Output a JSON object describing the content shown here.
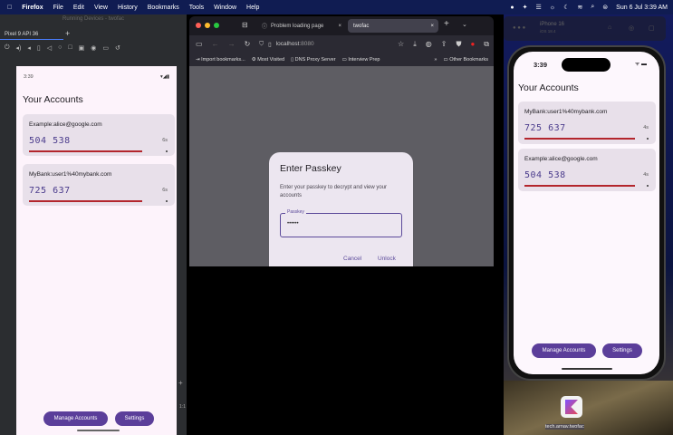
{
  "menubar": {
    "app": "Firefox",
    "items": [
      "File",
      "Edit",
      "View",
      "History",
      "Bookmarks",
      "Tools",
      "Window",
      "Help"
    ],
    "clock": "Sun 6 Jul  3:39 AM"
  },
  "studio": {
    "title": "Running Devices - twofac",
    "device_tab": "Pixel 9 API 36",
    "zoom_label": "1:1"
  },
  "android": {
    "time": "3:39",
    "heading": "Your Accounts",
    "accounts": [
      {
        "name": "Example:alice@google.com",
        "code": "504 538",
        "seconds": "6s",
        "progress": 0.85
      },
      {
        "name": "MyBank:user1%40mybank.com",
        "code": "725 637",
        "seconds": "6s",
        "progress": 0.85
      }
    ],
    "manage_label": "Manage Accounts",
    "settings_label": "Settings"
  },
  "firefox": {
    "tabs": [
      {
        "label": "Problem loading page"
      },
      {
        "label": "twofac"
      }
    ],
    "url_host": "localhost",
    "url_port": ":8080",
    "bookmarks": [
      "Import bookmarks...",
      "Most Visited",
      "DNS Proxy Server",
      "Interview Prep"
    ],
    "other_bookmarks": "Other Bookmarks"
  },
  "dialog": {
    "title": "Enter Passkey",
    "message": "Enter your passkey to decrypt and view your accounts",
    "field_label": "Passkey",
    "field_value": "••••••",
    "cancel": "Cancel",
    "unlock": "Unlock"
  },
  "simulator": {
    "device": "iPhone 16",
    "os": "iOS 18.4",
    "time": "3:39",
    "heading": "Your Accounts",
    "accounts": [
      {
        "name": "MyBank:user1%40mybank.com",
        "code": "725 637",
        "seconds": "4s",
        "progress": 0.9
      },
      {
        "name": "Example:alice@google.com",
        "code": "504 538",
        "seconds": "4s",
        "progress": 0.9
      }
    ],
    "manage_label": "Manage Accounts",
    "settings_label": "Settings"
  },
  "desktop": {
    "app_icon_label": "tech.arnav.twofac"
  }
}
